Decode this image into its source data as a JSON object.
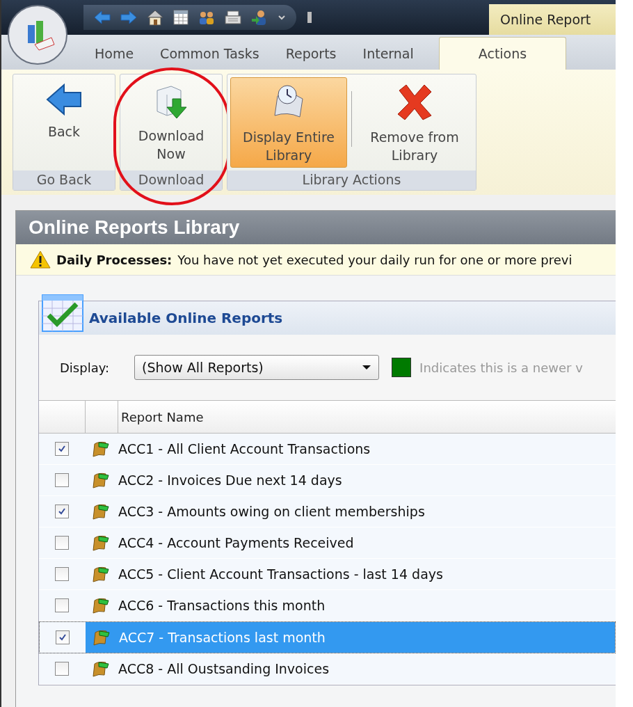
{
  "title_bar": {
    "context_tab": "Online Report"
  },
  "tabs": [
    {
      "label": "Home",
      "selected": false
    },
    {
      "label": "Common Tasks",
      "selected": false
    },
    {
      "label": "Reports",
      "selected": false
    },
    {
      "label": "Internal",
      "selected": false
    },
    {
      "label": "Actions",
      "selected": true
    }
  ],
  "ribbon_groups": [
    {
      "label": "Go Back",
      "circled": false,
      "buttons": [
        {
          "kind": "back",
          "label": "Back",
          "selected": false
        }
      ]
    },
    {
      "label": "Download",
      "circled": true,
      "buttons": [
        {
          "kind": "download",
          "label": "Download Now",
          "selected": false
        }
      ]
    },
    {
      "label": "Library Actions",
      "circled": false,
      "buttons": [
        {
          "kind": "library",
          "label": "Display Entire Library",
          "selected": true
        },
        {
          "kind": "remove",
          "label": "Remove from Library",
          "selected": false
        }
      ]
    }
  ],
  "panel": {
    "title": "Online Reports Library",
    "warning": {
      "label": "Daily Processes:",
      "text": "You have not yet executed your daily run for one or more previ"
    },
    "group": {
      "title": "Available Online Reports",
      "display": {
        "label": "Display:",
        "value": "(Show All Reports)"
      },
      "legend": {
        "color": "#007a00",
        "text": "Indicates this is a newer v"
      },
      "table": {
        "columns": [
          "Report Name"
        ],
        "rows": [
          {
            "name": "ACC1 - All Client Account Transactions",
            "checked": true,
            "selected": false
          },
          {
            "name": "ACC2 - Invoices Due next 14 days",
            "checked": false,
            "selected": false
          },
          {
            "name": "ACC3 - Amounts owing on client memberships",
            "checked": true,
            "selected": false
          },
          {
            "name": "ACC4 - Account Payments Received",
            "checked": false,
            "selected": false
          },
          {
            "name": "ACC5 - Client Account Transactions - last 14 days",
            "checked": false,
            "selected": false
          },
          {
            "name": "ACC6 - Transactions this month",
            "checked": false,
            "selected": false
          },
          {
            "name": "ACC7 - Transactions last month",
            "checked": true,
            "selected": true
          },
          {
            "name": "ACC8 - All Oustsanding Invoices",
            "checked": false,
            "selected": false
          }
        ]
      }
    }
  }
}
